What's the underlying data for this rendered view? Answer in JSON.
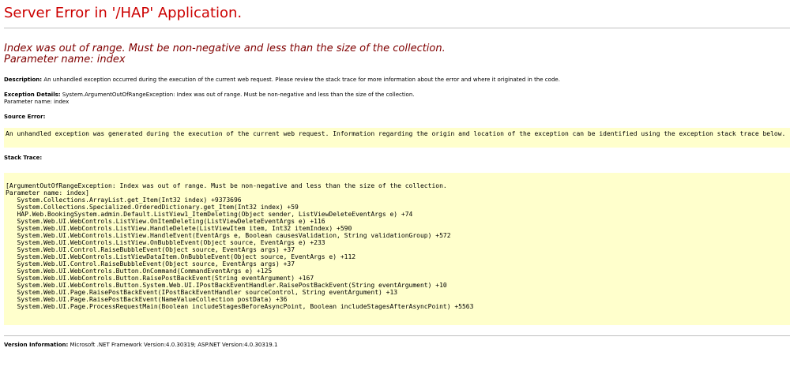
{
  "page": {
    "title": "Server Error in '/HAP' Application.",
    "error_message_line1": "Index was out of range. Must be non-negative and less than the size of the collection.",
    "error_message_line2": "Parameter name: index"
  },
  "description": {
    "label": "Description:",
    "text": "An unhandled exception occurred during the execution of the current web request. Please review the stack trace for more information about the error and where it originated in the code."
  },
  "exception_details": {
    "label": "Exception Details:",
    "text": "System.ArgumentOutOfRangeException: Index was out of range. Must be non-negative and less than the size of the collection.",
    "text2": "Parameter name: index"
  },
  "source_error": {
    "label": "Source Error:",
    "text": "An unhandled exception was generated during the execution of the current web request. Information regarding the origin and location of the exception can be identified using the exception stack trace below."
  },
  "stack_trace": {
    "label": "Stack Trace:",
    "lines": [
      "[ArgumentOutOfRangeException: Index was out of range. Must be non-negative and less than the size of the collection.",
      "Parameter name: index]",
      "   System.Collections.ArrayList.get_Item(Int32 index) +9373696",
      "   System.Collections.Specialized.OrderedDictionary.get_Item(Int32 index) +59",
      "   HAP.Web.BookingSystem.admin.Default.ListView1_ItemDeleting(Object sender, ListViewDeleteEventArgs e) +74",
      "   System.Web.UI.WebControls.ListView.OnItemDeleting(ListViewDeleteEventArgs e) +116",
      "   System.Web.UI.WebControls.ListView.HandleDelete(ListViewItem item, Int32 itemIndex) +590",
      "   System.Web.UI.WebControls.ListView.HandleEvent(EventArgs e, Boolean causesValidation, String validationGroup) +572",
      "   System.Web.UI.WebControls.ListView.OnBubbleEvent(Object source, EventArgs e) +233",
      "   System.Web.UI.Control.RaiseBubbleEvent(Object source, EventArgs args) +37",
      "   System.Web.UI.WebControls.ListViewDataItem.OnBubbleEvent(Object source, EventArgs e) +112",
      "   System.Web.UI.Control.RaiseBubbleEvent(Object source, EventArgs args) +37",
      "   System.Web.UI.WebControls.Button.OnCommand(CommandEventArgs e) +125",
      "   System.Web.UI.WebControls.Button.RaisePostBackEvent(String eventArgument) +167",
      "   System.Web.UI.WebControls.Button.System.Web.UI.IPostBackEventHandler.RaisePostBackEvent(String eventArgument) +10",
      "   System.Web.UI.Page.RaisePostBackEvent(IPostBackEventHandler sourceControl, String eventArgument) +13",
      "   System.Web.UI.Page.RaisePostBackEvent(NameValueCollection postData) +36",
      "   System.Web.UI.Page.ProcessRequestMain(Boolean includeStagesBeforeAsyncPoint, Boolean includeStagesAfterAsyncPoint) +5563"
    ]
  },
  "version": {
    "label": "Version Information:",
    "text": "Microsoft .NET Framework Version:4.0.30319; ASP.NET Version:4.0.30319.1"
  },
  "colors": {
    "title": "#cc0000",
    "error_message": "#800000",
    "code_background": "#ffffcc",
    "rule": "#c0c0c0"
  }
}
